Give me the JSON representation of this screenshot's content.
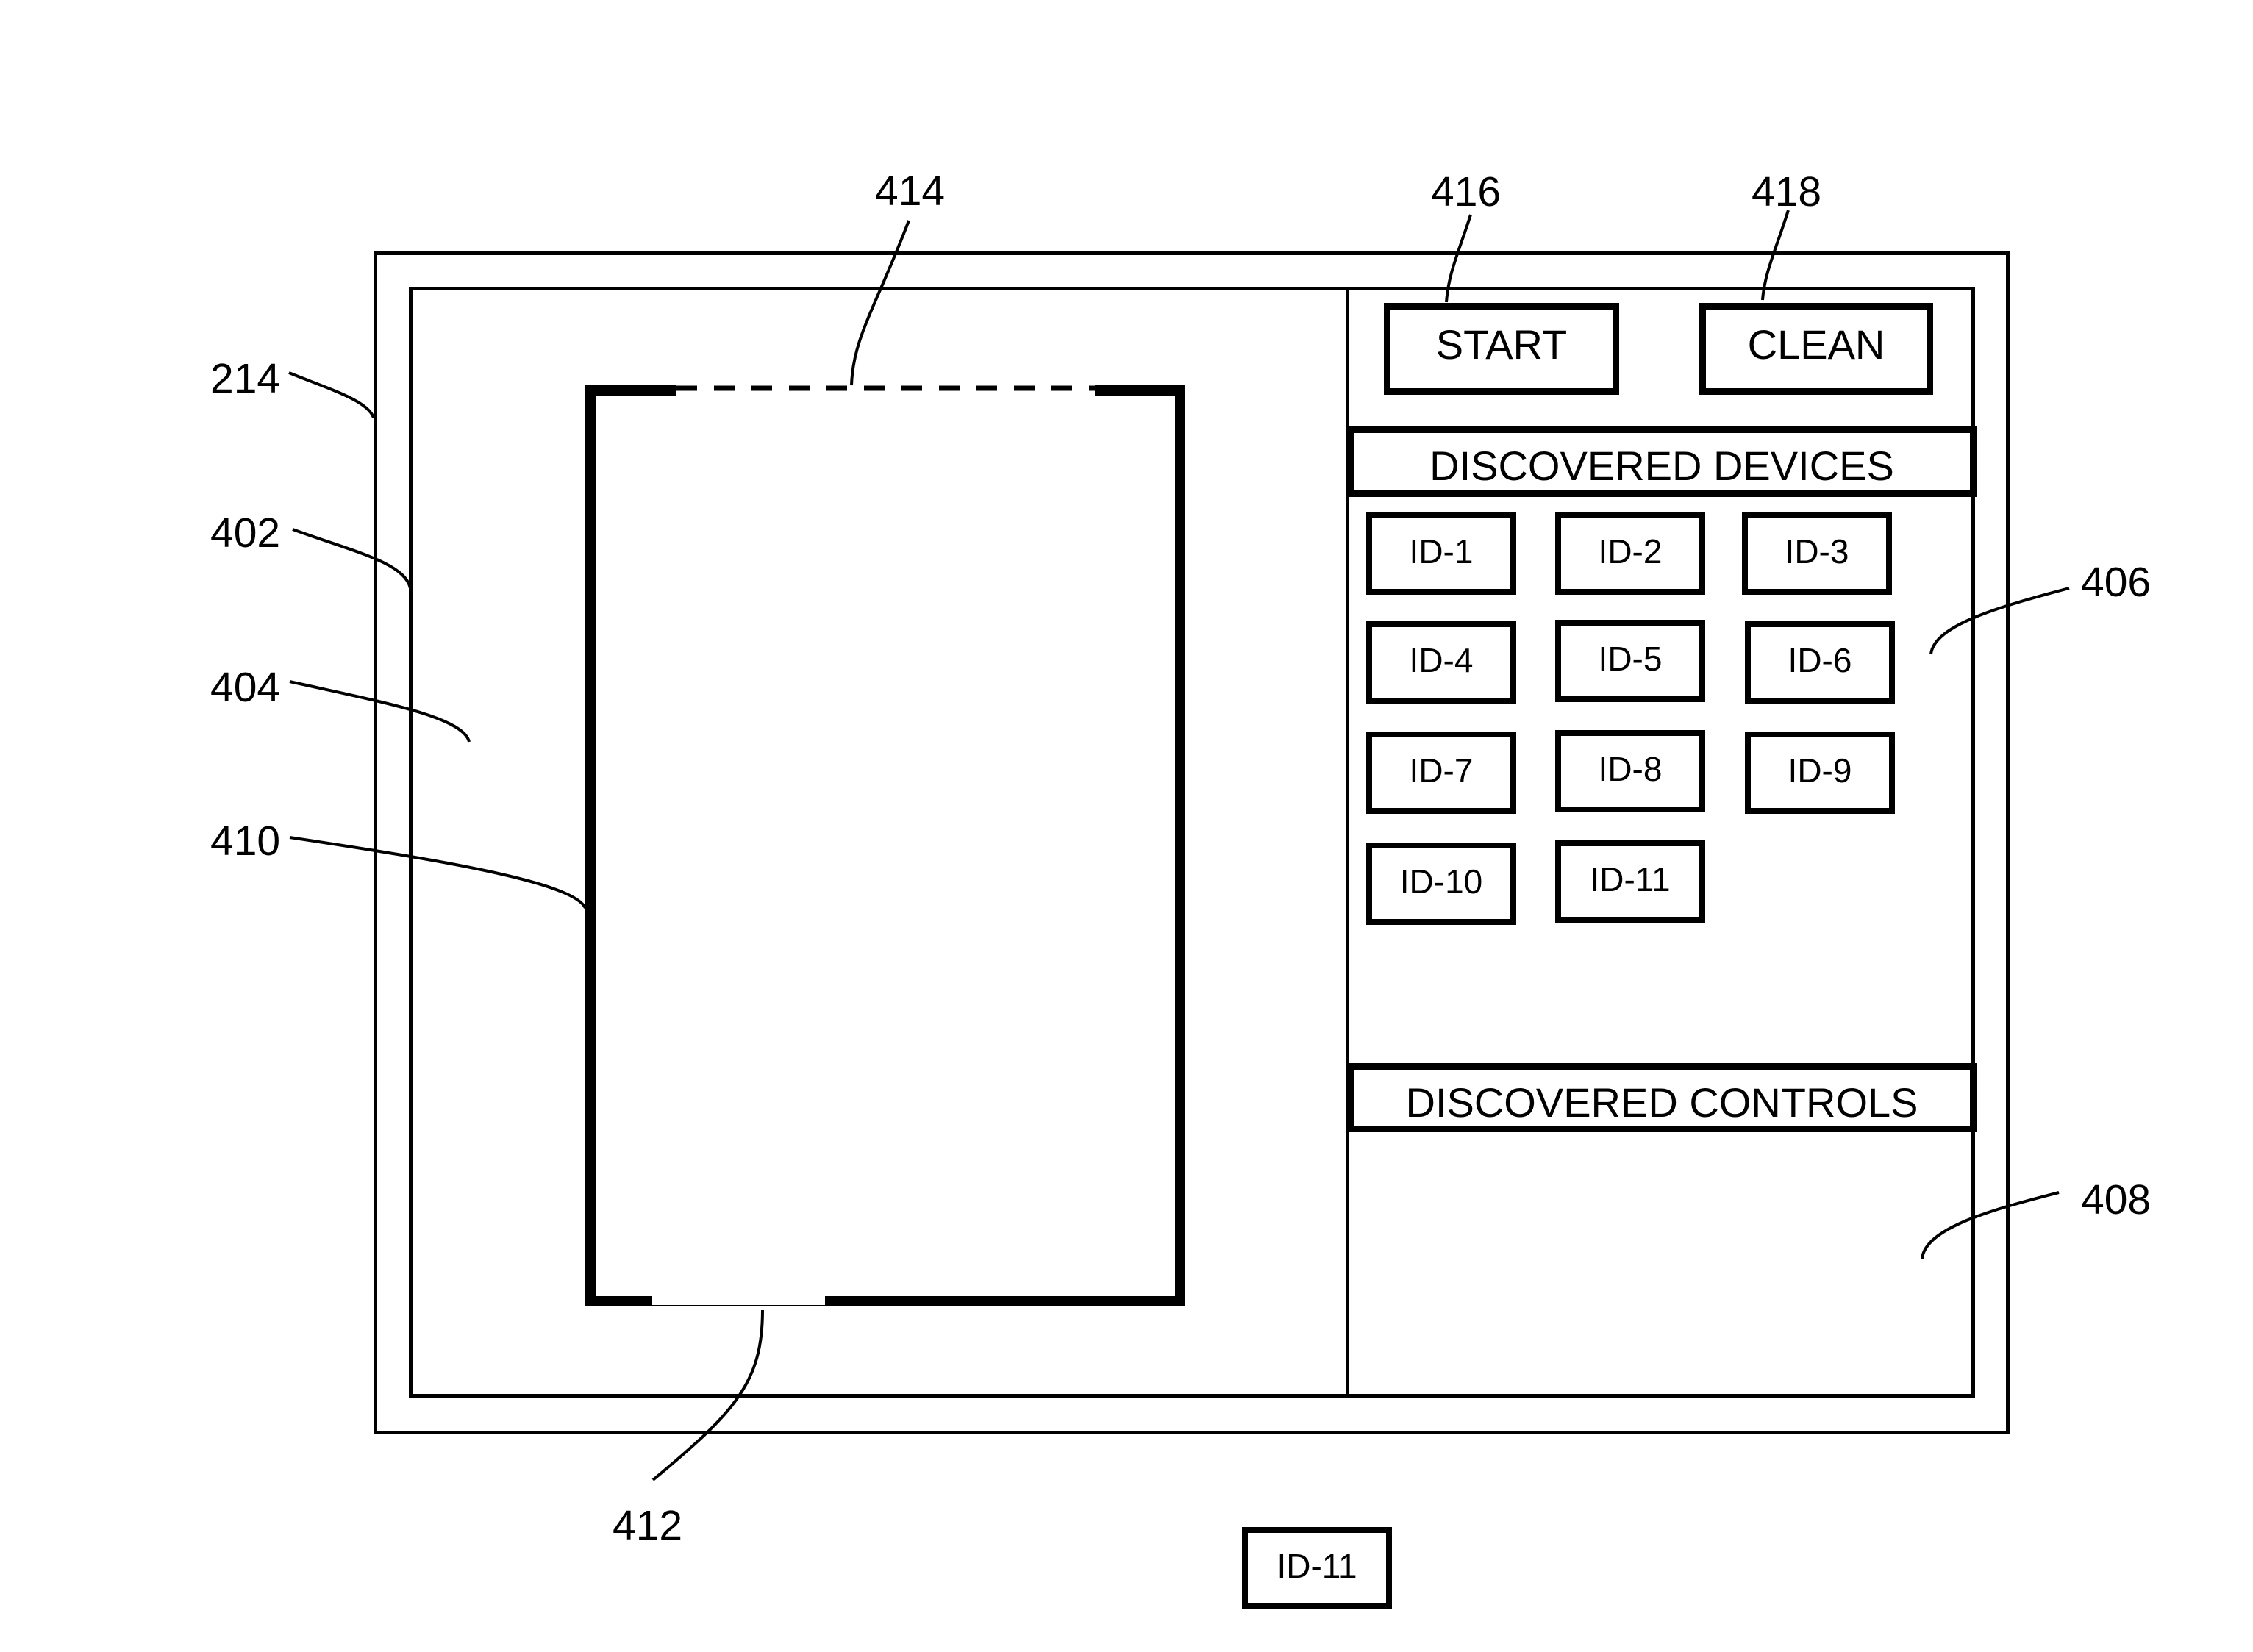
{
  "screen": {
    "ref": "214",
    "window_ref": "402"
  },
  "map_panel": {
    "ref": "404",
    "room": {
      "ref": "410",
      "door_ref": "412",
      "open_wall_ref": "414"
    }
  },
  "toolbar": {
    "start_label": "START",
    "start_ref": "416",
    "clean_label": "CLEAN",
    "clean_ref": "418"
  },
  "devices_panel": {
    "title": "DISCOVERED DEVICES",
    "ref": "406",
    "devices": [
      {
        "label": "ID-1"
      },
      {
        "label": "ID-2"
      },
      {
        "label": "ID-3"
      },
      {
        "label": "ID-4"
      },
      {
        "label": "ID-5"
      },
      {
        "label": "ID-6"
      },
      {
        "label": "ID-7"
      },
      {
        "label": "ID-8"
      },
      {
        "label": "ID-9"
      },
      {
        "label": "ID-10"
      },
      {
        "label": "ID-11"
      }
    ]
  },
  "controls_panel": {
    "title": "DISCOVERED CONTROLS",
    "ref": "408"
  },
  "dragged_device": {
    "label": "ID-11"
  }
}
